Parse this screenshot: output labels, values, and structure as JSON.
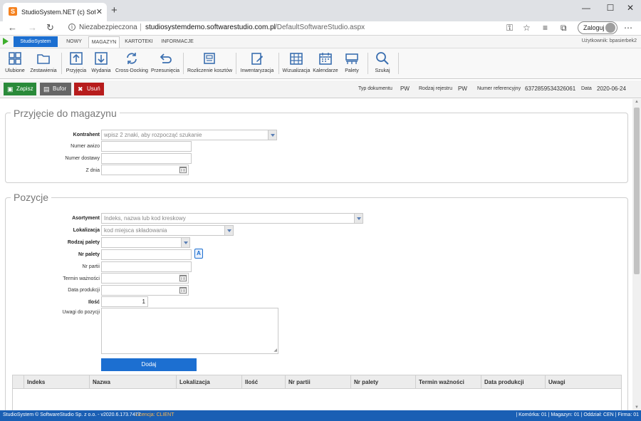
{
  "browser": {
    "tab_title": "StudioSystem.NET (c) SoftwareSt...",
    "url_status": "Niezabezpieczona",
    "url_host": "studiosystemdemo.softwarestudio.com.pl",
    "url_path": "/DefaultSoftwareStudio.aspx",
    "login_label": "Zaloguj"
  },
  "menu": {
    "brand": "StudioSystem",
    "tabs": [
      {
        "label": "NOWY"
      },
      {
        "label": "MAGAZYN"
      },
      {
        "label": "KARTOTEKI"
      },
      {
        "label": "INFORMACJE"
      }
    ],
    "active_tab": "MAGAZYN",
    "user_info": "Użytkownik: bpasierbek2"
  },
  "toolbar": {
    "items": [
      {
        "label": "Ulubione",
        "icon": "grid-icon"
      },
      {
        "label": "Zestawienia",
        "icon": "folder-icon"
      },
      {
        "label": "Przyjęcia",
        "icon": "upload-box-icon"
      },
      {
        "label": "Wydania",
        "icon": "download-box-icon"
      },
      {
        "label": "Cross-Docking",
        "icon": "refresh-icon"
      },
      {
        "label": "Przesunięcia",
        "icon": "return-arrow-icon"
      },
      {
        "label": "Rozliczenie kosztów",
        "icon": "cash-register-icon"
      },
      {
        "label": "Inwentaryzacja",
        "icon": "clipboard-edit-icon"
      },
      {
        "label": "Wizualizacja",
        "icon": "shelves-icon"
      },
      {
        "label": "Kalendarze",
        "icon": "calendar-icon"
      },
      {
        "label": "Palety",
        "icon": "pallet-icon"
      },
      {
        "label": "Szukaj",
        "icon": "search-icon"
      }
    ]
  },
  "actions": {
    "save": "Zapisz",
    "buffer": "Bufor",
    "delete": "Usuń"
  },
  "document_meta": {
    "doc_type_label": "Typ dokumentu",
    "doc_type_value": "PW",
    "register_label": "Rodzaj rejestru",
    "register_value": "PW",
    "ref_label": "Numer referencyjny",
    "ref_value": "6372859534326061",
    "date_label": "Data",
    "date_value": "2020-06-24"
  },
  "receipt": {
    "title": "Przyjęcie do magazynu",
    "contractor_label": "Kontrahent",
    "contractor_placeholder": "wpisz 2 znaki, aby rozpocząć szukanie",
    "advice_label": "Numer awizo",
    "delivery_label": "Numer dostawy",
    "date_label": "Z dnia"
  },
  "positions": {
    "title": "Pozycje",
    "assortment_label": "Asortyment",
    "assortment_placeholder": "Indeks, nazwa lub kod kreskowy",
    "location_label": "Lokalizacja",
    "location_placeholder": "kod miejsca składowania",
    "pallet_type_label": "Rodzaj palety",
    "pallet_no_label": "Nr palety",
    "batch_label": "Nr partii",
    "expiry_label": "Termin ważności",
    "production_label": "Data produkcji",
    "quantity_label": "Ilość",
    "quantity_value": "1",
    "notes_label": "Uwagi do pozycji",
    "add_button": "Dodaj"
  },
  "grid": {
    "columns": [
      "Indeks",
      "Nazwa",
      "Lokalizacja",
      "Ilość",
      "Nr partii",
      "Nr palety",
      "Termin ważności",
      "Data produkcji",
      "Uwagi"
    ]
  },
  "status": {
    "left": "StudioSystem © SoftwareStudio Sp. z o.o. - v2020.6.173.7477",
    "license": "Licencja: CLIENT",
    "right": "| Komórka: 01 | Magazyn: 01 | Oddział: CEN | Firma: 01"
  }
}
